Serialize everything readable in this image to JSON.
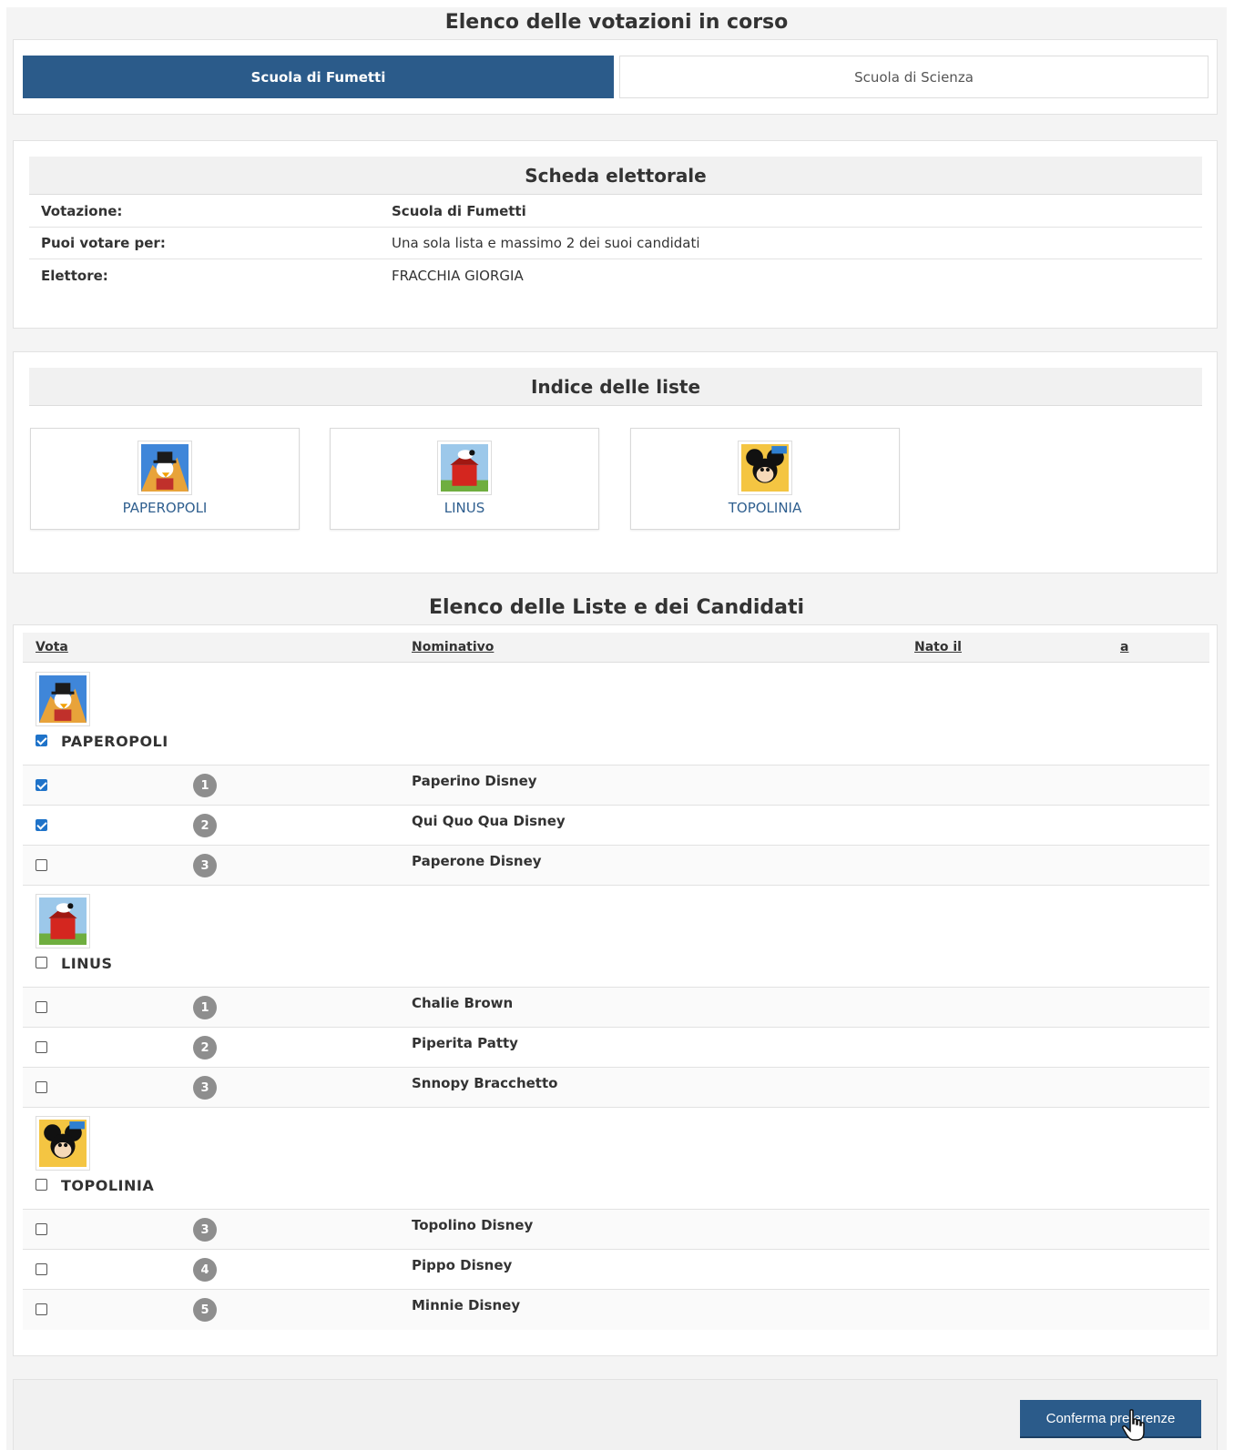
{
  "header": {
    "title": "Elenco delle votazioni in corso"
  },
  "tabs": [
    {
      "label": "Scuola di Fumetti",
      "active": true
    },
    {
      "label": "Scuola di Scienza",
      "active": false
    }
  ],
  "ballot": {
    "title": "Scheda elettorale",
    "rows": [
      {
        "key": "Votazione:",
        "value": "Scuola di Fumetti"
      },
      {
        "key": "Puoi votare per:",
        "value": "Una sola lista e massimo 2 dei suoi candidati"
      },
      {
        "key": "Elettore:",
        "value": "FRACCHIA GIORGIA"
      }
    ]
  },
  "index": {
    "title": "Indice delle liste",
    "cards": [
      {
        "label": "PAPEROPOLI",
        "icon": "paperopoli-logo-icon"
      },
      {
        "label": "LINUS",
        "icon": "linus-logo-icon"
      },
      {
        "label": "TOPOLINIA",
        "icon": "topolinia-logo-icon"
      }
    ]
  },
  "candidates_section": {
    "title": "Elenco delle Liste e dei Candidati",
    "columns": {
      "vote": "Vota",
      "name": "Nominativo",
      "born": "Nato il",
      "at": "a"
    },
    "lists": [
      {
        "name": "PAPEROPOLI",
        "checked": true,
        "candidates": [
          {
            "num": "1",
            "name": "Paperino Disney",
            "checked": true
          },
          {
            "num": "2",
            "name": "Qui Quo Qua Disney",
            "checked": true
          },
          {
            "num": "3",
            "name": "Paperone Disney",
            "checked": false
          }
        ]
      },
      {
        "name": "LINUS",
        "checked": false,
        "candidates": [
          {
            "num": "1",
            "name": "Chalie Brown",
            "checked": false
          },
          {
            "num": "2",
            "name": "Piperita Patty",
            "checked": false
          },
          {
            "num": "3",
            "name": "Snnopy Bracchetto",
            "checked": false
          }
        ]
      },
      {
        "name": "TOPOLINIA",
        "checked": false,
        "candidates": [
          {
            "num": "3",
            "name": "Topolino Disney",
            "checked": false
          },
          {
            "num": "4",
            "name": "Pippo Disney",
            "checked": false
          },
          {
            "num": "5",
            "name": "Minnie Disney",
            "checked": false
          }
        ]
      }
    ]
  },
  "actions": {
    "confirm_label": "Conferma preferenze"
  },
  "colors": {
    "primary": "#2b5b8a",
    "checkbox": "#1f73c9",
    "badge": "#8e8e8e"
  }
}
